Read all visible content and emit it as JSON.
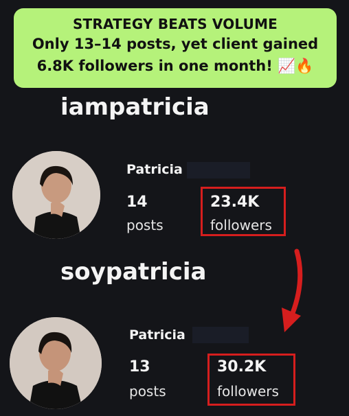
{
  "banner": {
    "title": "STRATEGY BEATS VOLUME",
    "line1": "Only 13–14 posts, yet client gained",
    "line2": "6.8K followers in one month! 📈🔥"
  },
  "before": {
    "handle": "iampatricia",
    "name": "Patricia",
    "posts_count": "14",
    "posts_label": "posts",
    "followers_count": "23.4K",
    "followers_label": "followers"
  },
  "after": {
    "handle": "soypatricia",
    "name": "Patricia",
    "posts_count": "13",
    "posts_label": "posts",
    "followers_count": "30.2K",
    "followers_label": "followers"
  },
  "colors": {
    "banner": "#b5f27a",
    "highlight": "#d61e1e",
    "background": "#141519"
  }
}
